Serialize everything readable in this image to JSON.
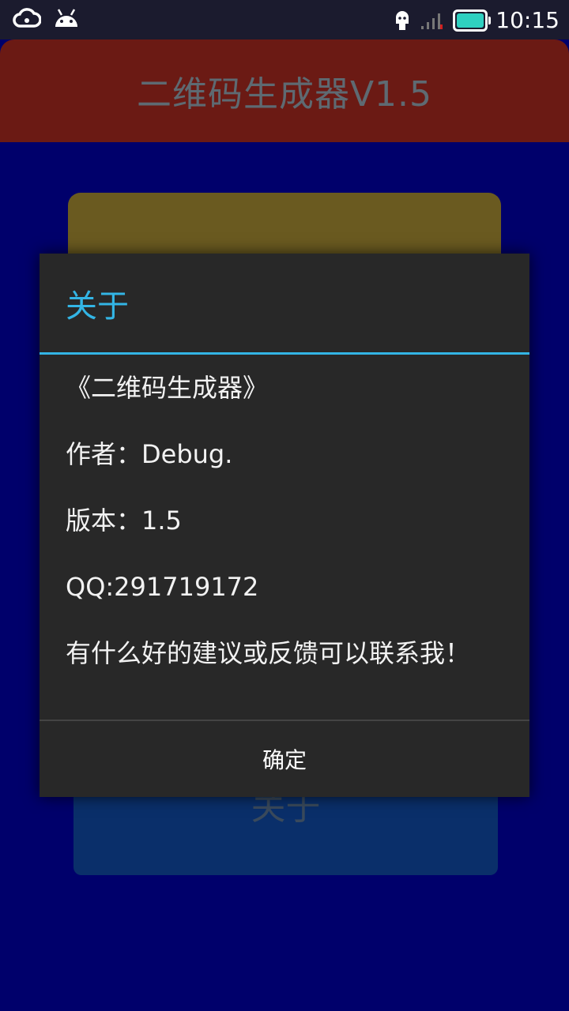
{
  "status_bar": {
    "time": "10:15",
    "icons": [
      "cloud-icon",
      "android-icon",
      "usb-debug-icon",
      "signal-icon",
      "battery-icon"
    ],
    "battery_color": "#2fd0c0"
  },
  "app": {
    "title": "二维码生成器V1.5",
    "header_color": "#6b1a14",
    "background_color": "#00006b",
    "about_button_label": "关于"
  },
  "dialog": {
    "title": "关于",
    "accent_color": "#33b5e5",
    "lines": [
      "《二维码生成器》",
      "作者：Debug.",
      "版本：1.5",
      "QQ:291719172",
      "有什么好的建议或反馈可以联系我！"
    ],
    "ok_label": "确定"
  }
}
